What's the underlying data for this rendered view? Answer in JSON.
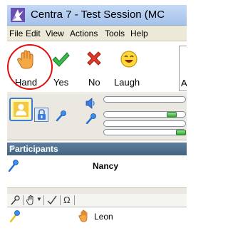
{
  "window": {
    "title": "Centra 7 - Test Session (MC"
  },
  "menu": {
    "items": [
      "File",
      "Edit",
      "View",
      "Actions",
      "Tools",
      "Help"
    ]
  },
  "toolbar": {
    "buttons": [
      {
        "label": "Hand",
        "icon": "hand-icon"
      },
      {
        "label": "Yes",
        "icon": "checkmark-icon"
      },
      {
        "label": "No",
        "icon": "x-icon"
      },
      {
        "label": "Laugh",
        "icon": "laugh-icon"
      }
    ],
    "overflow_label": "A"
  },
  "audio": {
    "speaker_volume": 0.8,
    "mic_volume": 0.95
  },
  "participants": {
    "header": "Participants",
    "presenter": "Nancy",
    "list": [
      {
        "name": "Leon",
        "status_icon": "raised-hand-icon",
        "mic": true
      }
    ]
  },
  "colors": {
    "highlight": "#e10e0e",
    "header_bg": "#4f708c",
    "slider_green": "#2fa12f"
  }
}
